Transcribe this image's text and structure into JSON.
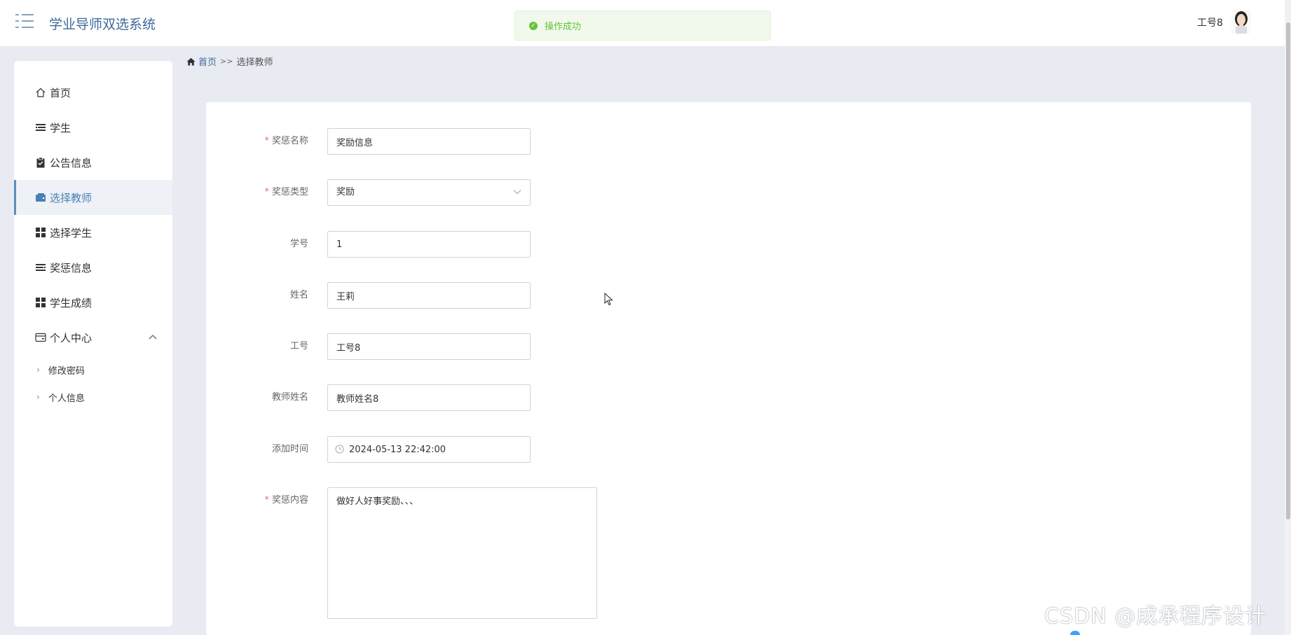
{
  "header": {
    "app_title": "学业导师双选系统",
    "toast_message": "操作成功",
    "user_name": "工号8"
  },
  "sidebar": {
    "items": [
      {
        "label": "首页"
      },
      {
        "label": "学生"
      },
      {
        "label": "公告信息"
      },
      {
        "label": "选择教师"
      },
      {
        "label": "选择学生"
      },
      {
        "label": "奖惩信息"
      },
      {
        "label": "学生成绩"
      },
      {
        "label": "个人中心"
      }
    ],
    "sub_items": [
      {
        "label": "修改密码"
      },
      {
        "label": "个人信息"
      }
    ],
    "active_item": "选择教师"
  },
  "breadcrumb": {
    "home": "首页",
    "separator": ">>",
    "current": "选择教师"
  },
  "form": {
    "fields": [
      {
        "label": "奖惩名称",
        "value": "奖励信息",
        "required": true
      },
      {
        "label": "奖惩类型",
        "value": "奖励",
        "required": true
      },
      {
        "label": "学号",
        "value": "1",
        "required": false
      },
      {
        "label": "姓名",
        "value": "王莉",
        "required": false
      },
      {
        "label": "工号",
        "value": "工号8",
        "required": false
      },
      {
        "label": "教师姓名",
        "value": "教师姓名8",
        "required": false
      },
      {
        "label": "添加时间",
        "value": "2024-05-13 22:42:00",
        "required": false
      },
      {
        "label": "奖惩内容",
        "value": "做好人好事奖励、、、",
        "required": true
      }
    ],
    "required_mark": "*"
  },
  "watermark": "CSDN @成承程序设计",
  "colors": {
    "brand": "#3c6a9a",
    "active_accent": "#5b8fbf",
    "success": "#67c23a",
    "required": "#f56c6c",
    "background": "#e9ebf3"
  }
}
